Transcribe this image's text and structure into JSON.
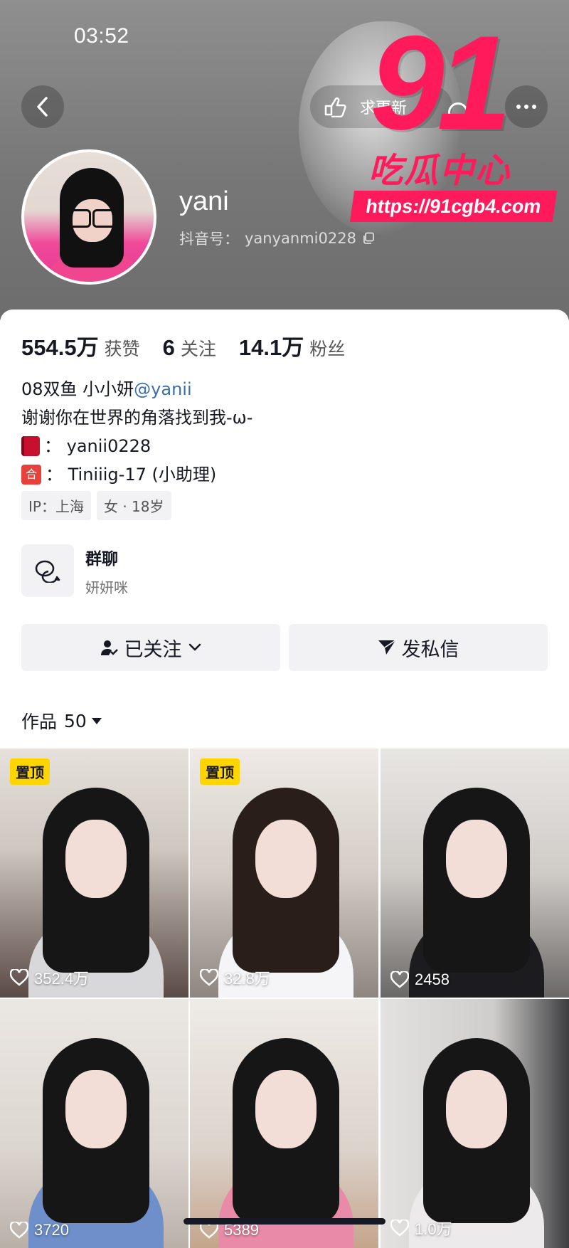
{
  "status_bar": {
    "time": "03:52"
  },
  "header": {
    "pill_text": "求更新",
    "nickname": "yani",
    "douyin_id_label": "抖音号：",
    "douyin_id": "yanyanmi0228"
  },
  "watermark": {
    "big": "91",
    "sub": "吃瓜中心",
    "url": "https://91cgb4.com"
  },
  "stats": [
    {
      "num": "554.5万",
      "label": "获赞"
    },
    {
      "num": "6",
      "label": "关注"
    },
    {
      "num": "14.1万",
      "label": "粉丝"
    }
  ],
  "bio": {
    "line1_text": "08双鱼 小小妍 ",
    "line1_mention": "@yanii",
    "line2": "谢谢你在世界的角落找到我-ω-",
    "line3_icon": "red-book-icon",
    "line3_text": "： yanii0228",
    "line4_icon_text": "合",
    "line4_text": "： Tiniiig-17 (小助理)"
  },
  "tags": [
    "IP：上海",
    "女 · 18岁"
  ],
  "group": {
    "title": "群聊",
    "subtitle": "妍妍咪"
  },
  "buttons": {
    "follow": "已关注",
    "message": "发私信"
  },
  "works": {
    "label": "作品",
    "count": "50"
  },
  "videos": [
    {
      "pinned": "置顶",
      "likes": "352.4万"
    },
    {
      "pinned": "置顶",
      "likes": "32.8万"
    },
    {
      "pinned": "",
      "likes": "2458"
    },
    {
      "pinned": "",
      "likes": "3720"
    },
    {
      "pinned": "",
      "likes": "5389"
    },
    {
      "pinned": "",
      "likes": "1.0万"
    }
  ],
  "colors": {
    "accent_pink": "#ff1a5c",
    "pin_yellow": "#ffd500",
    "mention_blue": "#3b6ea5"
  }
}
